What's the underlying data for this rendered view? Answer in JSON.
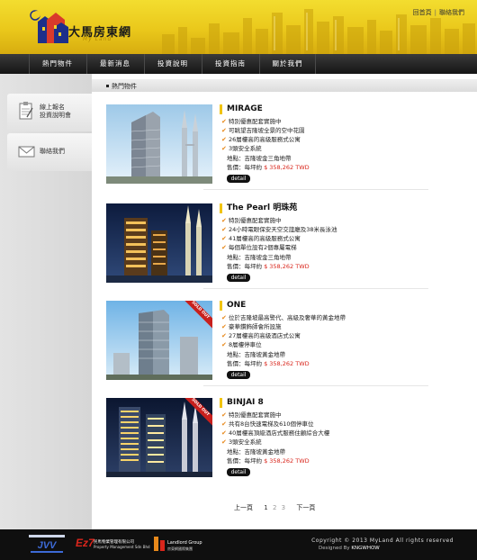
{
  "header": {
    "logo_title": "大馬房東網",
    "logo_sub": "My Land",
    "toplinks": [
      "回首頁",
      "聯絡我們"
    ]
  },
  "nav": {
    "items": [
      "熱門物件",
      "最新消息",
      "投資說明",
      "投資指南",
      "關於我們"
    ]
  },
  "sidebar": {
    "items": [
      {
        "label_line1": "線上報名",
        "label_line2": "投資說明會",
        "icon": "clipboard-icon"
      },
      {
        "label_line1": "聯絡我們",
        "label_line2": "",
        "icon": "envelope-icon"
      }
    ]
  },
  "breadcrumb": "熱門物件",
  "listings": [
    {
      "title": "MIRAGE",
      "features": [
        "特別優惠配套實施中",
        "可眺望吉隆坡全景的空中花園",
        "26層樓高的高級服務式公寓",
        "3頭安全系統"
      ],
      "address_label": "地點：",
      "address": "吉隆坡金三角地帶",
      "price_label": "售價：每坪約 ",
      "price": "$ 358,262 TWD",
      "detail": "detail",
      "sold_out": false
    },
    {
      "title": "The Pearl 明珠苑",
      "features": [
        "特別優惠配套實施中",
        "24小時電眼保安天空交誼廳及38米長泳池",
        "41層樓高的高級服務式公寓",
        "每個單位設有2個專屬電梯"
      ],
      "address_label": "地點：",
      "address": "吉隆坡金三角地帶",
      "price_label": "售價：每坪約 ",
      "price": "$ 358,262 TWD",
      "detail": "detail",
      "sold_out": false
    },
    {
      "title": "ONE",
      "features": [
        "位於吉隆坡最高警代、高級及奢華的黃金地帶",
        "豪華鑽飾師會所設施",
        "27層樓高的高級酒店式公寓",
        "8層樓停車位"
      ],
      "address_label": "地點：",
      "address": "吉隆坡黃金地帶",
      "price_label": "售價：每坪約 ",
      "price": "$ 358,262 TWD",
      "detail": "detail",
      "sold_out": true,
      "sold_text": "SOLD OUT"
    },
    {
      "title": "BINJAI 8",
      "features": [
        "特別優惠配套實施中",
        "共有8台快速電梯及610個停車位",
        "40層樓高頂級酒店式服務住顧綜合大樓",
        "3頭安全系統"
      ],
      "address_label": "地點：",
      "address": "吉隆坡黃金地帶",
      "price_label": "售價：每坪約 ",
      "price": "$ 358,262 TWD",
      "detail": "detail",
      "sold_out": true,
      "sold_text": "SOLD OUT"
    }
  ],
  "pager": {
    "prev": "上一頁",
    "pages": [
      "1",
      "2",
      "3"
    ],
    "next": "下一頁"
  },
  "footer": {
    "logo1": "JVV",
    "logo2_name": "Ez7",
    "logo2_text": "民馬物業管理有限公司",
    "logo2_sub": "Property Management Sdn Bhd",
    "logo3_text": "Landlord Group",
    "logo3_sub": "房東網國際集團",
    "copyright": "Copyright © 2013  MyLand All rights reserved",
    "designed_label": "Designed By",
    "designer": "KNGWHOW"
  },
  "colors": {
    "header_yellow": "#f1d02a",
    "nav_dark": "#1a1a1a",
    "accent_orange": "#e8891b",
    "price_red": "#d9261c",
    "title_mark": "#f1c40f"
  }
}
